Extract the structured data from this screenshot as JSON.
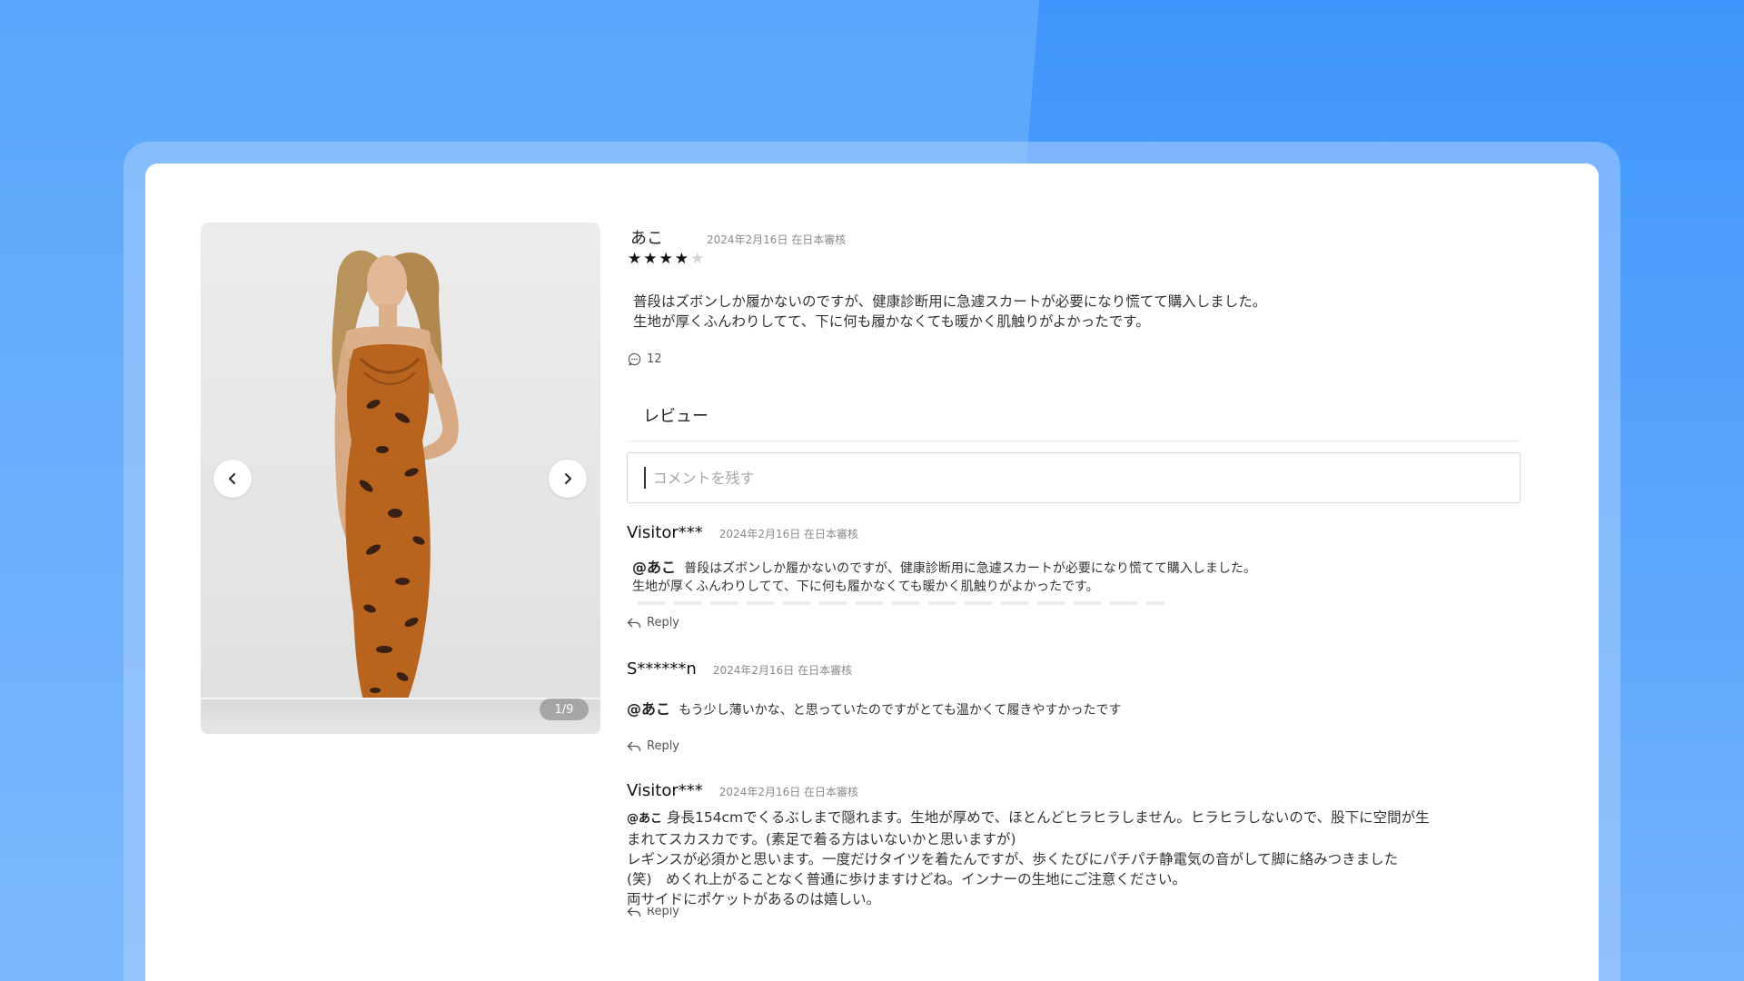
{
  "gallery": {
    "counter": "1/9",
    "prev_icon": "chevron-left-icon",
    "next_icon": "chevron-right-icon"
  },
  "review": {
    "author": "あこ",
    "date": "2024年2月16日 在日本審核",
    "rating": 4,
    "rating_max": 5,
    "body": "普段はズボンしか履かないのですが、健康診断用に急遽スカートが必要になり慌てて購入しました。\n生地が厚くふんわりしてて、下に何も履かなくても暖かく肌触りがよかったです。",
    "comment_count": "12"
  },
  "comments_section": {
    "title": "レビュー",
    "input_placeholder": "コメントを残す"
  },
  "replies": [
    {
      "author": "Visitor***",
      "date": "2024年2月16日 在日本審核",
      "mention": "@あこ",
      "text_line1": "普段はズボンしか履かないのですが、健康診断用に急遽スカートが必要になり慌てて購入しました。",
      "text_line2": "生地が厚くふんわりしてて、下に何も履かなくても暖かく肌触りがよかったです。",
      "reply_label": "Reply"
    },
    {
      "author": "S******n",
      "date": "2024年2月16日 在日本審核",
      "mention": "@あこ",
      "text": "もう少し薄いかな、と思っていたのですがとても温かくて履きやすかったです",
      "reply_label": "Reply"
    },
    {
      "author": "Visitor***",
      "date": "2024年2月16日 在日本審核",
      "mention": "@あこ",
      "text_line1": "身長154cmでくるぶしまで隠れます。生地が厚めで、ほとんどヒラヒラしません。ヒラヒラしないので、股下に空間が生",
      "text_line2": "まれてスカスカです。(素足で着る方はいないかと思いますが)",
      "text_line3": "レギンスが必須かと思います。一度だけタイツを着たんですが、歩くたびにパチパチ静電気の音がして脚に絡みつきました",
      "text_line4": "(笑)　めくれ上がることなく普通に歩けますけどね。インナーの生地にご注意ください。",
      "text_line5": "両サイドにポケットがあるのは嬉しい。",
      "reply_label": "Reply"
    }
  ],
  "colors": {
    "background": "#5aa3fb",
    "card": "#ffffff",
    "star_on": "#111111",
    "star_off": "#d4d4d4"
  }
}
